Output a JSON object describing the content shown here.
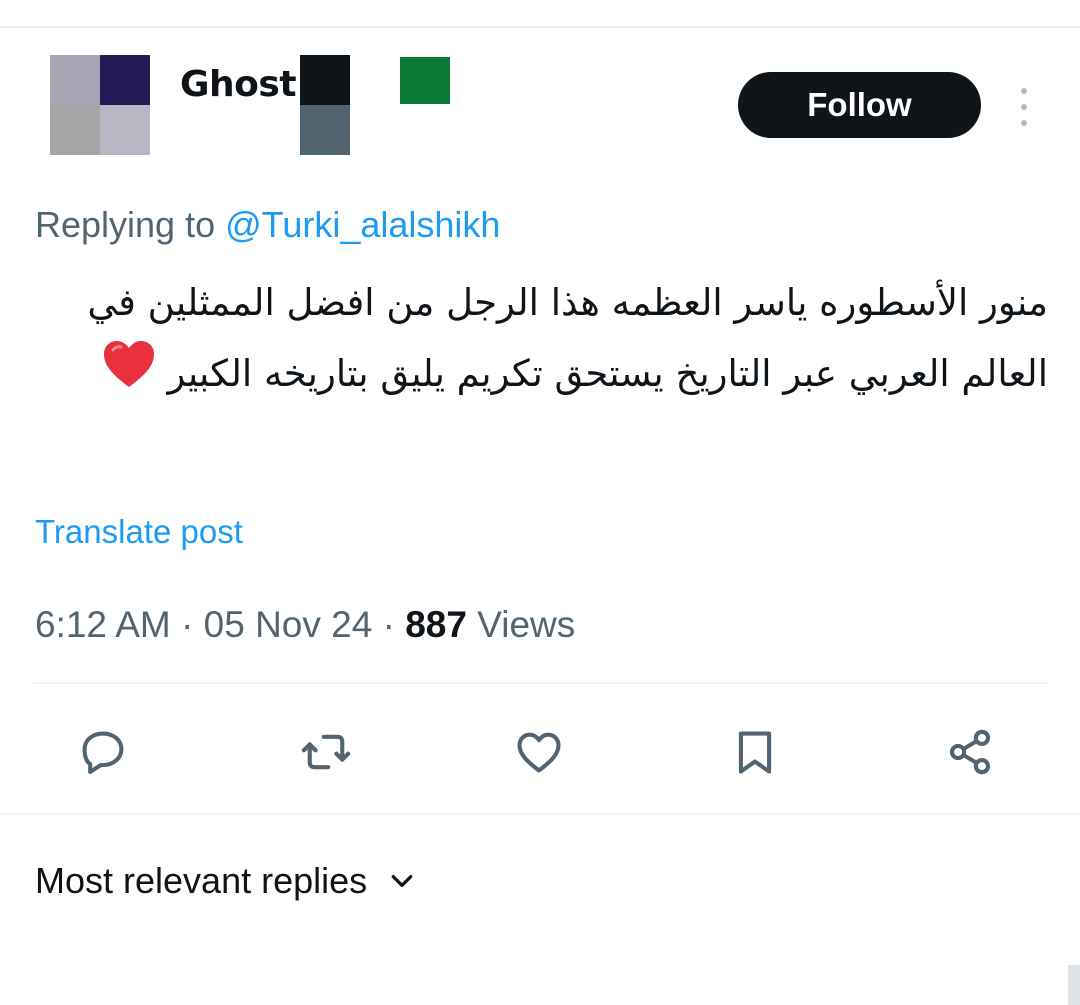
{
  "post": {
    "author": {
      "display_name": "Ghost"
    },
    "follow_label": "Follow",
    "replying_prefix": "Replying to",
    "replying_handle": "@Turki_alalshikh",
    "text": "منور الأسطوره ياسر العظمه هذا الرجل من افضل الممثلين في العالم العربي عبر التاريخ يستحق تكريم يليق بتاريخه الكبير",
    "emoji": "red-heart",
    "translate_label": "Translate post",
    "time": "6:12 AM",
    "date": "05 Nov 24",
    "views_count": "887",
    "views_label": "Views"
  },
  "actions": [
    {
      "icon": "reply-icon"
    },
    {
      "icon": "repost-icon"
    },
    {
      "icon": "like-icon"
    },
    {
      "icon": "bookmark-icon"
    },
    {
      "icon": "share-icon"
    }
  ],
  "replies_section": {
    "sort_label": "Most relevant replies",
    "icon": "chevron-down-icon"
  },
  "colors": {
    "accent": "#1d9bf0",
    "text_primary": "#0f1419",
    "text_secondary": "#536471",
    "follow_bg": "#0f1419",
    "heart": "#e8303e",
    "flag": "#0b7a37"
  }
}
